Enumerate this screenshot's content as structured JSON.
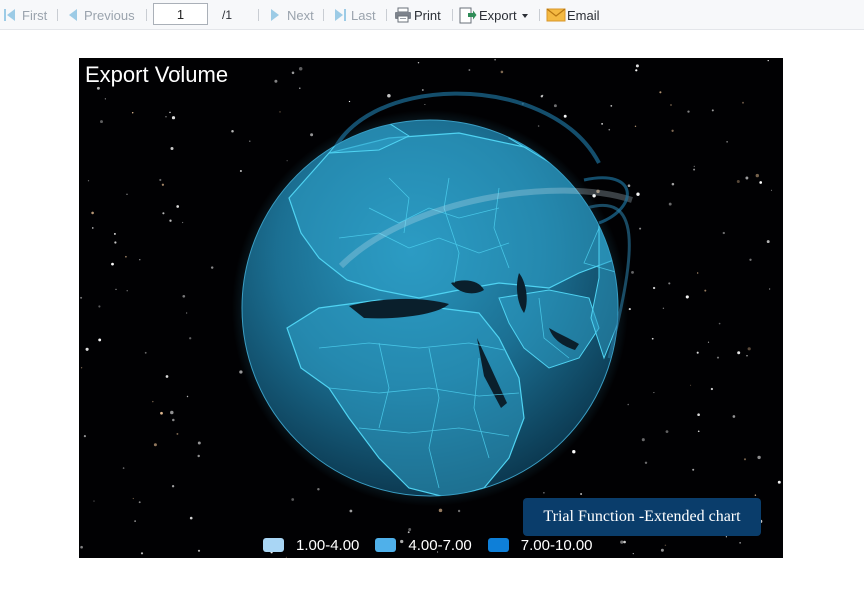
{
  "toolbar": {
    "first_label": "First",
    "previous_label": "Previous",
    "page_value": "1",
    "total_pages": "/1",
    "next_label": "Next",
    "last_label": "Last",
    "print_label": "Print",
    "export_label": "Export",
    "email_label": "Email",
    "icons": [
      "first-page-icon",
      "previous-page-icon",
      "next-page-icon",
      "last-page-icon",
      "printer-icon",
      "export-icon",
      "envelope-icon"
    ]
  },
  "chart": {
    "title": "Export Volume",
    "trial_notice": "Trial Function -Extended chart",
    "legend": [
      {
        "label": "1.00-4.00",
        "color": "#a9d6f5"
      },
      {
        "label": "4.00-7.00",
        "color": "#4fb0ea"
      },
      {
        "label": "7.00-10.00",
        "color": "#0e7fd8"
      }
    ],
    "colors": {
      "background": "#010103",
      "globe": "#1f7fa6",
      "border_lines": "#4fd3f2",
      "land": "#2d9ec6"
    }
  }
}
